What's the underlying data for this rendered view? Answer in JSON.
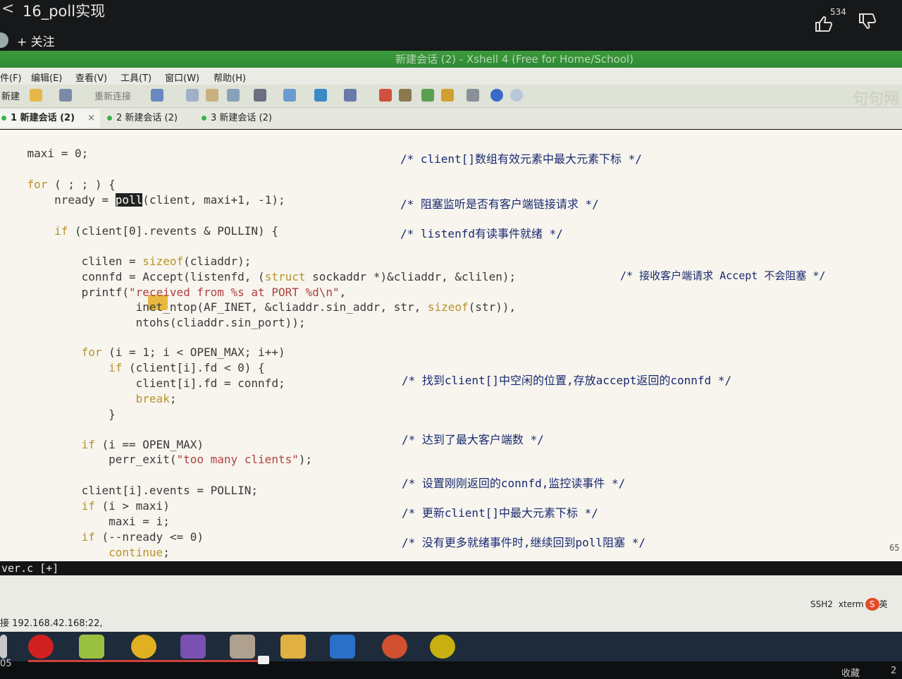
{
  "video": {
    "back": "<",
    "title": "16_poll实现",
    "follow": "+ 关注",
    "likes": "534",
    "collect": "收藏",
    "time": "05",
    "page_num": "2"
  },
  "window": {
    "title": "新建会话 (2) - Xshell 4 (Free for Home/School)"
  },
  "menu": [
    "件(F)",
    "编辑(E)",
    "查看(V)",
    "工具(T)",
    "窗口(W)",
    "帮助(H)"
  ],
  "toolbar": {
    "new_label": "新建",
    "reconnect_label": "重新连接",
    "watermark": "句句网"
  },
  "tabs": [
    {
      "label": "1 新建会话 (2)",
      "close": "×"
    },
    {
      "label": "2 新建会话 (2)"
    },
    {
      "label": "3 新建会话 (2)"
    }
  ],
  "code": [
    "    maxi = 0;",
    "    for ( ; ; ) {",
    "        nready = poll(client, maxi+1, -1);",
    "        if (client[0].revents & POLLIN) {",
    "            clilen = sizeof(cliaddr);",
    "            connfd = Accept(listenfd, (struct sockaddr *)&cliaddr, &clilen);",
    "            printf(\"received from %s at PORT %d\\n\",",
    "                    inet_ntop(AF_INET, &cliaddr.sin_addr, str, sizeof(str)),",
    "                    ntohs(cliaddr.sin_port));",
    "            for (i = 1; i < OPEN_MAX; i++)",
    "                if (client[i].fd < 0) {",
    "                    client[i].fd = connfd;",
    "                    break;",
    "                }",
    "            if (i == OPEN_MAX)",
    "                perr_exit(\"too many clients\");",
    "            client[i].events = POLLIN;",
    "            if (i > maxi)",
    "                maxi = i;",
    "            if (--nready <= 0)",
    "                continue;"
  ],
  "comments": [
    "/* client[]数组有效元素中最大元素下标 */",
    "/* 阻塞监听是否有客户端链接请求 */",
    "/* listenfd有读事件就绪 */",
    "/* 接收客户端请求 Accept 不会阻塞 */",
    "/* 找到client[]中空闲的位置,存放accept返回的connfd */",
    "/* 达到了最大客户端数 */",
    "/* 设置刚刚返回的connfd,监控读事件 */",
    "/* 更新client[]中最大元素下标 */",
    "/* 没有更多就绪事件时,继续回到poll阻塞 */"
  ],
  "editor": {
    "status_line": "ver.c [+]",
    "right_num": "65"
  },
  "statusbar": {
    "conn": "接 192.168.42.168:22,",
    "proto": "SSH2",
    "term": "xterm",
    "ime": "英"
  },
  "colors": {
    "title_green": "#3c9a3c",
    "keyword": "#b8922a",
    "string": "#b04040",
    "comment": "#1a2a70"
  }
}
